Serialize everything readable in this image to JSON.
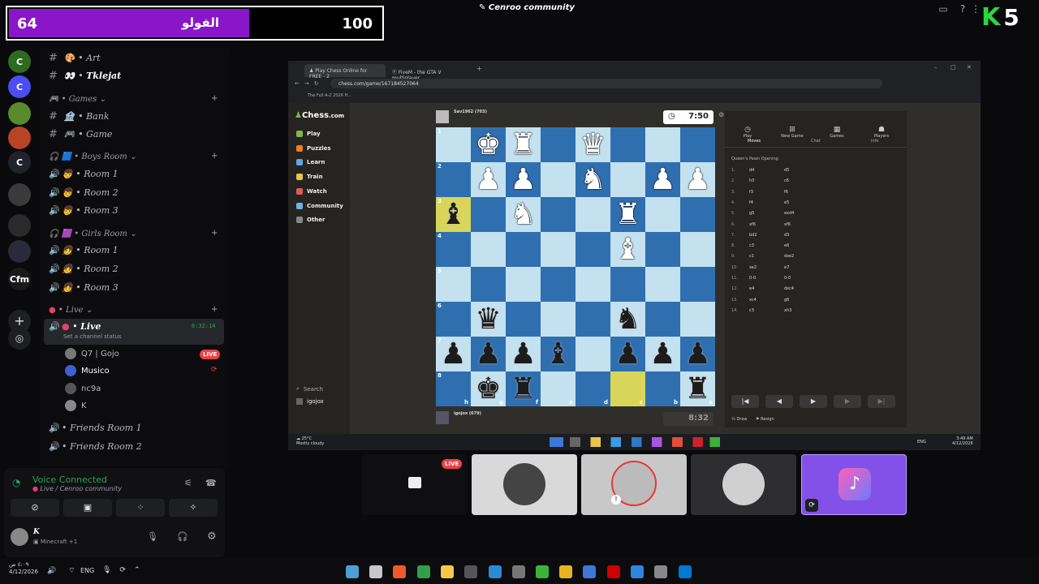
{
  "score_bar": {
    "left_value": "64",
    "arabic_label": "الفولو",
    "right_value": "100",
    "progress_percent": 64
  },
  "window_title": "Cenroo community",
  "brand": {
    "letter": "K",
    "number": "5"
  },
  "servers": [
    {
      "label": "C",
      "color": "#2d6b1f"
    },
    {
      "label": "C",
      "color": "#4b4df0"
    },
    {
      "label": "",
      "color": "#5a8a2b"
    },
    {
      "label": "",
      "color": "#b84325"
    },
    {
      "label": "C",
      "color": "#20232a"
    },
    {
      "label": "",
      "color": "#3a3a3a"
    },
    {
      "label": "",
      "color": "#2a2a2a"
    },
    {
      "label": "",
      "color": "#2a2a3a"
    },
    {
      "label": "Cfm",
      "color": "#1a1a1a"
    }
  ],
  "channels": {
    "top": [
      {
        "name": "Art"
      },
      {
        "name": "Tklejat"
      }
    ],
    "games_category": "Games",
    "games": [
      {
        "name": "Bank"
      },
      {
        "name": "Game"
      }
    ],
    "boys_category": "Boys Room",
    "boys": [
      {
        "name": "Room 1"
      },
      {
        "name": "Room 2"
      },
      {
        "name": "Room 3"
      }
    ],
    "girls_category": "Girls Room",
    "girls": [
      {
        "name": "Room 1"
      },
      {
        "name": "Room 2"
      },
      {
        "name": "Room 3"
      }
    ],
    "live_category": "Live",
    "live_channel": "Live",
    "live_timer": "6:32:14",
    "channel_status": "Set a channel status",
    "live_users": [
      "Q7 | Gojo",
      "Musico",
      "nc9a",
      "K"
    ],
    "live_badge": "LIVE",
    "friends": [
      {
        "name": "Friends Room 1"
      },
      {
        "name": "Friends Room 2"
      }
    ]
  },
  "voice": {
    "status": "Voice Connected",
    "location": "Live / Cenroo community",
    "username": "K",
    "activity": "Minecraft +1"
  },
  "browser": {
    "tabs": [
      "Play Chess Online for FREE - 2",
      "FiveM - the GTA V multiplayer"
    ],
    "url": "chess.com/game/167184527064",
    "bookmark": "The Full A-Z 2026 H..."
  },
  "chess": {
    "logo_main": "Chess",
    "logo_suffix": ".com",
    "nav": [
      "Play",
      "Puzzles",
      "Learn",
      "Train",
      "Watch",
      "Community",
      "Other"
    ],
    "nav_colors": [
      "#81b64c",
      "#f57c1f",
      "#5fa8e6",
      "#e6c84a",
      "#e05a5a",
      "#6fb0e6",
      "#888888"
    ],
    "nav_bottom": [
      "Search",
      "igojox"
    ],
    "top_player": "Sav1962 (703)",
    "top_clock": "7:50",
    "bottom_player": "igojox (679)",
    "bottom_clock": "8:32",
    "board": [
      [
        "",
        "wK",
        "wR",
        "",
        "wQ",
        "",
        "",
        ""
      ],
      [
        "",
        "wP",
        "wP",
        "",
        "wN",
        "",
        "wP",
        "wP"
      ],
      [
        "bB",
        "",
        "wN",
        "",
        "",
        "wR",
        "",
        ""
      ],
      [
        "",
        "",
        "",
        "",
        "",
        "wB",
        "",
        ""
      ],
      [
        "",
        "",
        "",
        "",
        "",
        "",
        "",
        ""
      ],
      [
        "",
        "bQ",
        "",
        "",
        "",
        "bN",
        "",
        ""
      ],
      [
        "bP",
        "bP",
        "bP",
        "bB",
        "",
        "bP",
        "bP",
        "bP"
      ],
      [
        "",
        "bK",
        "bR",
        "",
        "",
        "",
        "",
        "bR"
      ]
    ],
    "highlights": [
      [
        2,
        0
      ],
      [
        7,
        5
      ]
    ],
    "ranks": [
      "1",
      "2",
      "3",
      "4",
      "5",
      "6",
      "7",
      "8"
    ],
    "files": [
      "h",
      "g",
      "f",
      "e",
      "d",
      "c",
      "b",
      "a"
    ],
    "panel_tabs": [
      "Play",
      "New Game",
      "Games",
      "Players"
    ],
    "sub_tabs": [
      "Moves",
      "Chat",
      "Info"
    ],
    "opening": "Queen's Pawn Opening",
    "moves": [
      [
        "1.",
        "d4",
        "d5"
      ],
      [
        "2.",
        "h3",
        "c6"
      ],
      [
        "3.",
        "f3",
        "f6"
      ],
      [
        "4.",
        "f4",
        "e5"
      ],
      [
        "5.",
        "g5",
        "exd4"
      ],
      [
        "6.",
        "xf6",
        "xf6"
      ],
      [
        "7.",
        "bd2",
        "d3"
      ],
      [
        "8.",
        "c3",
        "e6"
      ],
      [
        "9.",
        "c1",
        "dxe2"
      ],
      [
        "10.",
        "xe2",
        "e7"
      ],
      [
        "11.",
        "0-0",
        "0-0"
      ],
      [
        "12.",
        "e4",
        "dxc4"
      ],
      [
        "13.",
        "xc4",
        "g6"
      ],
      [
        "14.",
        "c3",
        "xh3"
      ]
    ],
    "actions": [
      "Draw",
      "Resign"
    ]
  },
  "win_taskbar": {
    "weather": "25°C",
    "weather_desc": "Mostly cloudy",
    "lang": "ENG",
    "time": "3:49 AM",
    "date": "4/12/2026"
  },
  "stream_tiles": {
    "live_badge": "LIVE"
  },
  "taskbar": {
    "time": "٤:٠٩ ص",
    "date": "4/12/2026",
    "lang": "ENG"
  }
}
